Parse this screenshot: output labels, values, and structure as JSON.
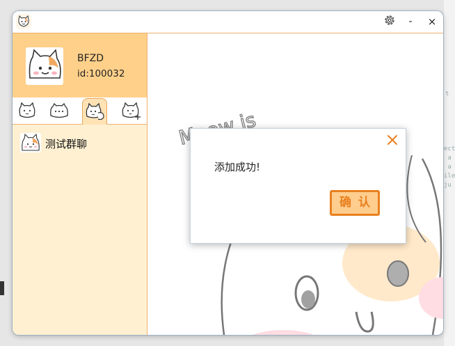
{
  "window": {
    "logo_icon": "cat-face-icon",
    "controls": {
      "settings_icon": "gear-icon",
      "minimize": "-",
      "close": "×"
    }
  },
  "profile": {
    "username": "BFZD",
    "user_id": "id:100032",
    "avatar_icon": "cat-avatar-icon"
  },
  "tabs": [
    {
      "icon": "cat-head-icon"
    },
    {
      "icon": "cat-chat-icon"
    },
    {
      "icon": "cat-group-icon",
      "active": true
    },
    {
      "icon": "cat-add-icon"
    }
  ],
  "chat_list": [
    {
      "name": "测试群聊",
      "avatar_icon": "cat-avatar-icon"
    }
  ],
  "wallpaper": {
    "text": "Meow is"
  },
  "dialog": {
    "message": "添加成功!",
    "confirm_label": "确认",
    "close_icon": "close-icon"
  },
  "colors": {
    "accent": "#e8801f",
    "profile_bg": "#ffd08a",
    "sidebar_bg": "#fff0d2",
    "button_bg": "#ffcd8e"
  }
}
